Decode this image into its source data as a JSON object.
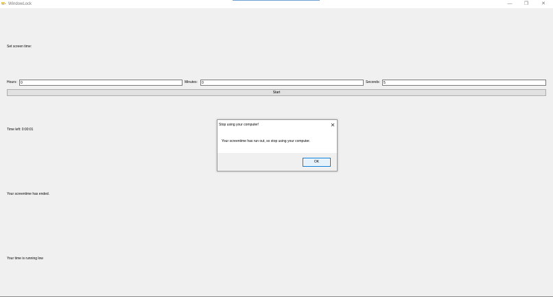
{
  "window": {
    "title": "WindowLock",
    "icon_text": "W▪",
    "icon": "app-logo-icon",
    "controls": {
      "minimize": "—",
      "maximize": "❐",
      "close": "✕"
    }
  },
  "main": {
    "set_time_label": "Set screen time:",
    "hours": {
      "label": "Hours:",
      "value": "0"
    },
    "minutes": {
      "label": "Minutes:",
      "value": "0"
    },
    "seconds": {
      "label": "Seconds:",
      "value": "5"
    },
    "start_label": "Start",
    "time_left": "Time left: 0:00:01",
    "ended_message": "Your screentime has ended.",
    "low_message": "Your time is running low"
  },
  "dialog": {
    "title": "Stop using your computer!",
    "close_glyph": "✕",
    "message": "Your screentime has run out, so stop using your computer.",
    "ok_label": "OK"
  },
  "colors": {
    "background": "#f0f0f0",
    "accent": "#0078d7"
  }
}
